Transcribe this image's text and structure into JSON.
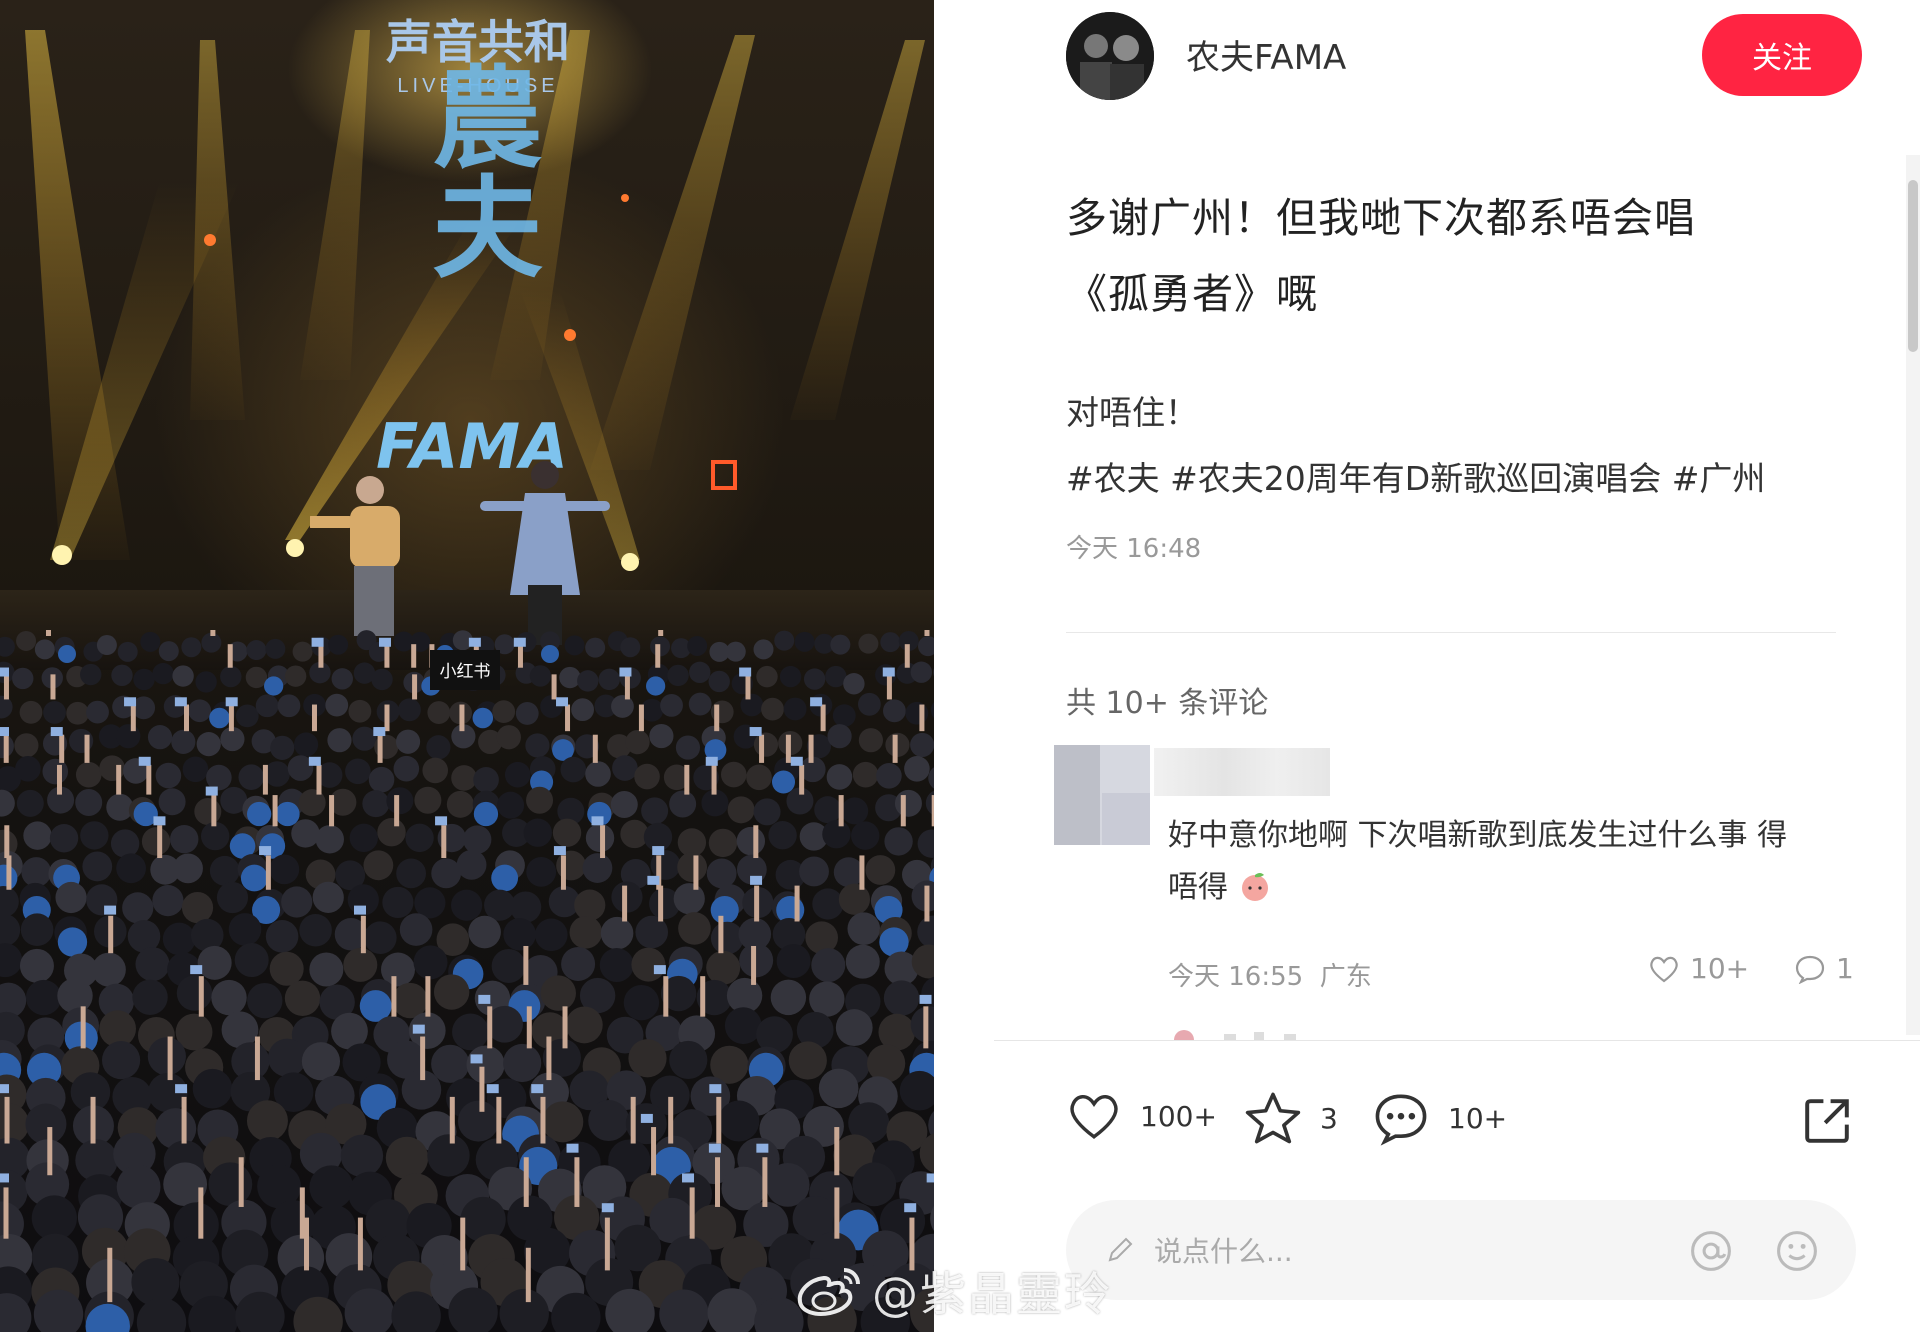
{
  "photo": {
    "venue_sign_main": "声音共和",
    "venue_sign_sub": "LIVE-HOUSE",
    "screen_text_1": "農夫",
    "screen_text_2": "FAMA",
    "stage_banner": "小红书"
  },
  "header": {
    "author_name": "农夫FAMA",
    "follow_label": "关注"
  },
  "post": {
    "title_line1": "多谢广州！但我哋下次都系唔会唱",
    "title_line2": "《孤勇者》嘅",
    "body_line1": "对唔住！",
    "tags": [
      "#农夫",
      "#农夫20周年有D新歌巡回演唱会",
      "#广州"
    ],
    "time": "今天 16:48",
    "comment_count": "共 10+ 条评论"
  },
  "comment": {
    "text_line1": "好中意你地啊 下次唱新歌到底发生过什么事 得",
    "text_line2": "唔得",
    "time": "今天 16:55",
    "location": "广东",
    "likes": "10+",
    "replies": "1"
  },
  "actions": {
    "likes": "100+",
    "favorites": "3",
    "comments": "10+"
  },
  "input": {
    "placeholder": "说点什么..."
  },
  "watermark": {
    "text": "@紫晶靈玲"
  },
  "colors": {
    "accent": "#ff2442",
    "muted": "#999999"
  }
}
